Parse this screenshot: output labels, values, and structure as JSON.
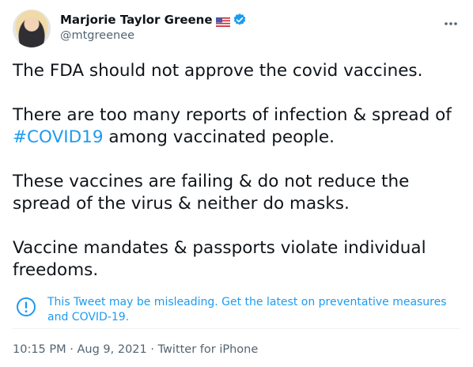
{
  "author": {
    "display_name": "Marjorie Taylor Greene",
    "handle": "@mtgreenee",
    "flag_icon": "us-flag-icon",
    "verified_icon": "verified-badge-icon",
    "verified_color": "#1d9bf0"
  },
  "tweet": {
    "line1": "The FDA should not approve the covid vaccines.",
    "line2_pre": "There are too many reports of infection & spread of ",
    "hashtag": "#COVID19",
    "line2_post": " among vaccinated people.",
    "line3": "These vaccines are failing & do not reduce the spread of the virus & neither do masks.",
    "line4": "Vaccine mandates & passports violate individual freedoms."
  },
  "notice": {
    "icon": "exclamation-circle-icon",
    "text": "This Tweet may be misleading. Get the latest on preventative measures and COVID-19."
  },
  "meta": {
    "time": "10:15 PM",
    "separator": " · ",
    "date": "Aug 9, 2021",
    "source": "Twitter for iPhone"
  },
  "colors": {
    "text": "#0f1419",
    "secondary": "#536471",
    "link": "#1d9bf0"
  }
}
